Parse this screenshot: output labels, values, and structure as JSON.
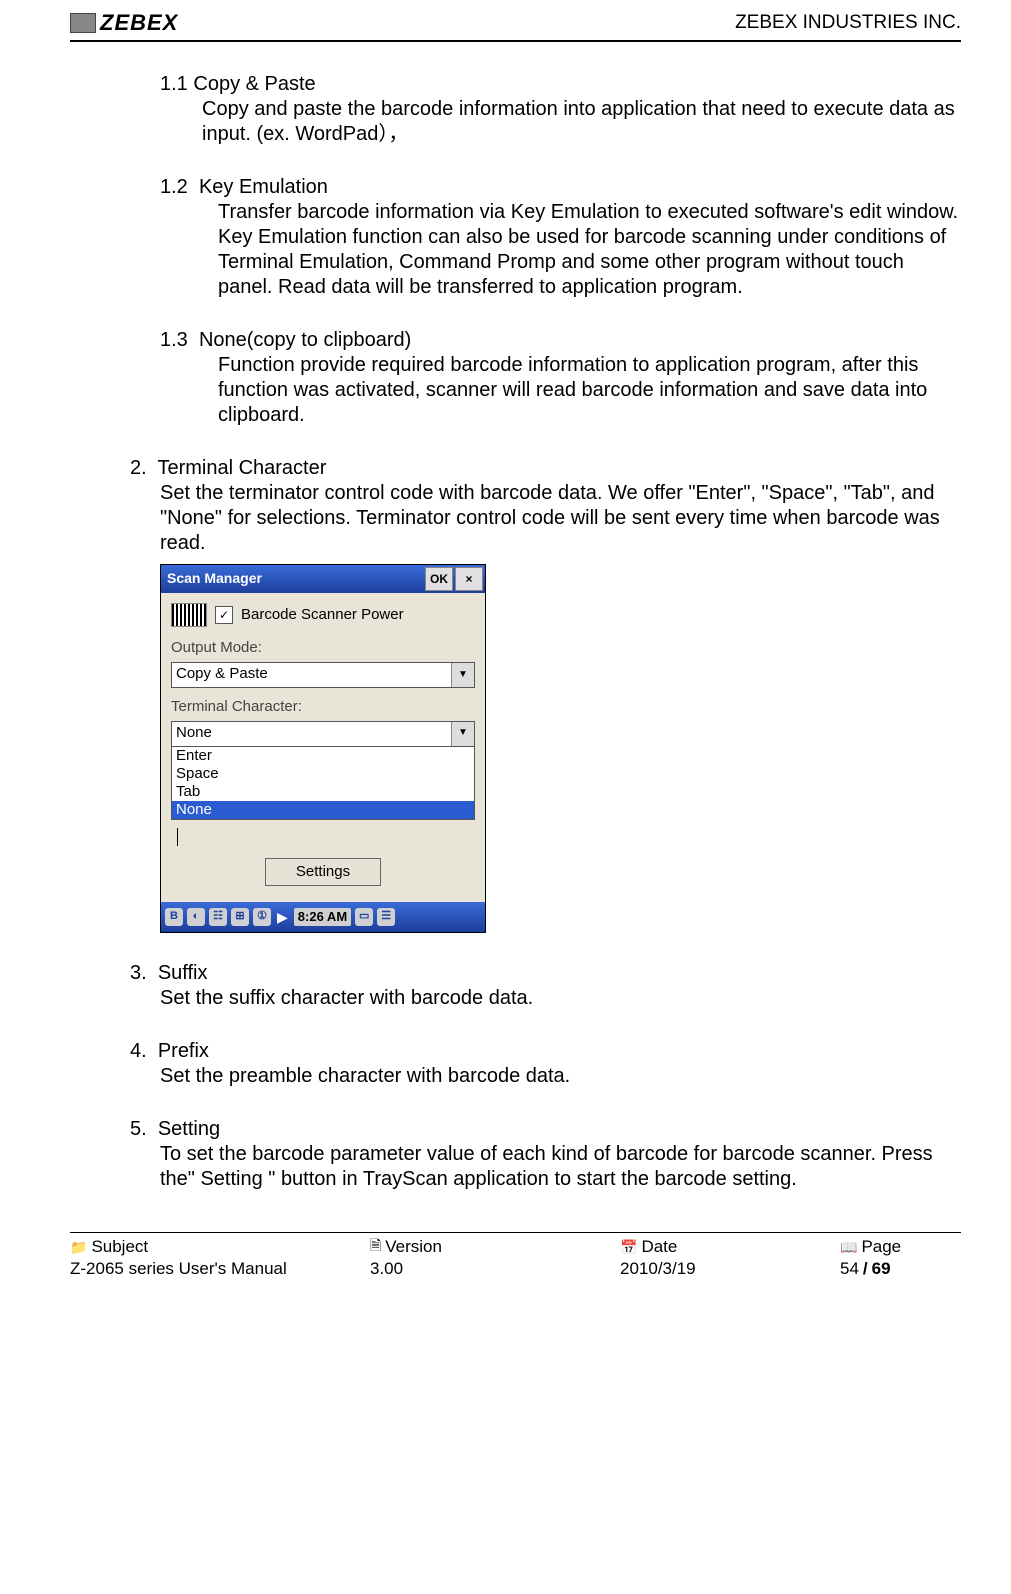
{
  "header": {
    "logo_text": "ZEBEX",
    "company": "ZEBEX INDUSTRIES INC."
  },
  "sections": {
    "s11": {
      "num": "1.1",
      "title": "Copy & Paste",
      "body": "Copy and paste the barcode information into application that need to execute data as input. (ex. WordPad），"
    },
    "s12": {
      "num": "1.2",
      "title": "Key Emulation",
      "body": "Transfer barcode information via Key Emulation to executed software's edit window. Key Emulation function can also be used for barcode scanning under conditions of Terminal Emulation, Command Promp and some other program without touch panel. Read data will be transferred to application program."
    },
    "s13": {
      "num": "1.3",
      "title": "None(copy to clipboard)",
      "body": "Function provide required barcode information to application program, after this function was activated, scanner will read barcode information and save data into clipboard."
    },
    "s2": {
      "num": "2.",
      "title": "Terminal Character",
      "body": "Set the terminator control code with barcode data. We offer \"Enter\", \"Space\", \"Tab\", and \"None\" for selections. Terminator control code will be sent every time when barcode was read."
    },
    "s3": {
      "num": "3.",
      "title": "Suffix",
      "body": "Set the suffix character with barcode data."
    },
    "s4": {
      "num": "4.",
      "title": "Prefix",
      "body": "Set the preamble character with barcode data."
    },
    "s5": {
      "num": "5.",
      "title": "Setting",
      "body": "To set the barcode parameter value of each kind of barcode for barcode scanner. Press the\" Setting \" button in TrayScan application to start the barcode setting."
    }
  },
  "scanmanager": {
    "title": "Scan Manager",
    "ok": "OK",
    "close": "×",
    "checkbox_checked": "✓",
    "power_label": "Barcode Scanner Power",
    "output_mode_label": "Output Mode:",
    "output_mode_value": "Copy & Paste",
    "terminal_label": "Terminal Character:",
    "terminal_value": "None",
    "options": {
      "o0": "Enter",
      "o1": "Space",
      "o2": "Tab",
      "o3": "None"
    },
    "settings_btn": "Settings",
    "taskbar": {
      "b": "B",
      "time_prefix": "▶",
      "time": "8:26 AM"
    }
  },
  "footer": {
    "labels": {
      "subject": "Subject",
      "version": "Version",
      "date": "Date",
      "page": "Page"
    },
    "values": {
      "subject": "Z-2065 series User's Manual",
      "version": "3.00",
      "date": "2010/3/19",
      "page_cur": "54",
      "page_sep": " / ",
      "page_total": "69"
    }
  }
}
